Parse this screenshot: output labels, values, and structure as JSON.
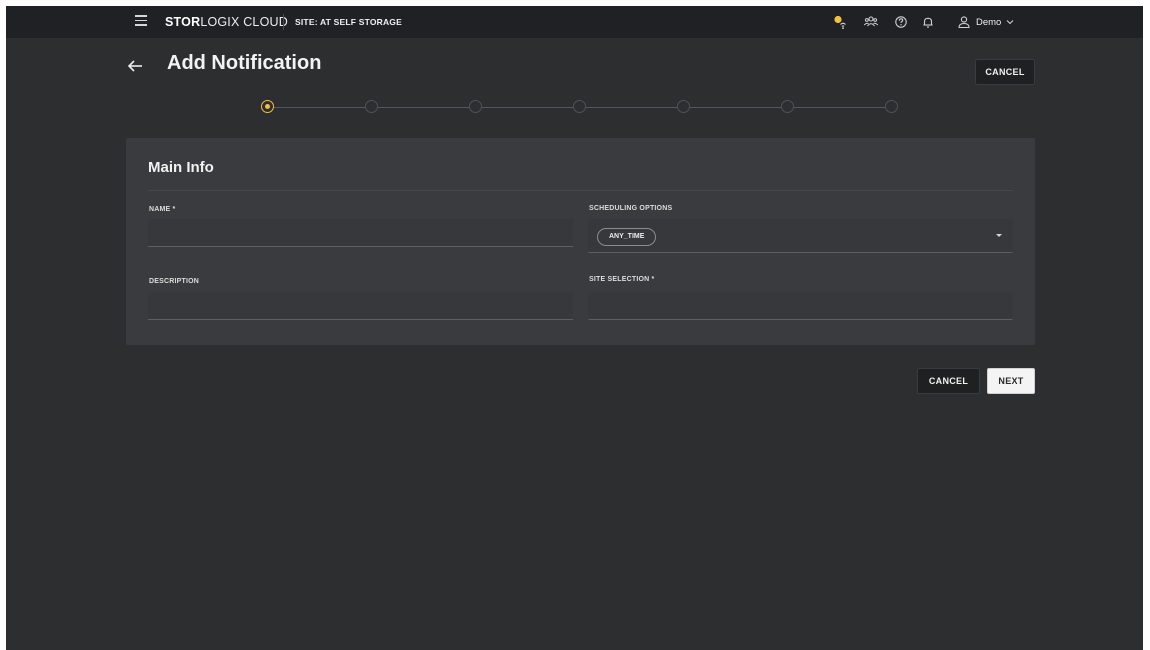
{
  "topbar": {
    "brand_bold": "STOR",
    "brand_rest": "LOGIX CLOUD",
    "site_label": "SITE: AT SELF STORAGE",
    "user_name": "Demo"
  },
  "header": {
    "title": "Add Notification",
    "cancel_label": "CANCEL"
  },
  "stepper": {
    "total_steps": 7,
    "active_step": 1
  },
  "card": {
    "title": "Main Info",
    "name_label": "NAME *",
    "name_value": "",
    "description_label": "DESCRIPTION",
    "description_value": "",
    "scheduling_label": "SCHEDULING OPTIONS",
    "scheduling_chip": "ANY_TIME",
    "site_selection_label": "SITE SELECTION *",
    "site_selection_value": ""
  },
  "footer": {
    "cancel_label": "CANCEL",
    "next_label": "NEXT"
  },
  "colors": {
    "accent": "#f2c044",
    "background": "#2d2e30",
    "topbar": "#202124",
    "card": "#3a3b3e"
  },
  "icons": {
    "menu": "hamburger-menu-icon",
    "weather": "sun-cloud-icon",
    "people": "people-icon",
    "help": "help-circle-icon",
    "notifications": "bell-icon",
    "user": "user-icon",
    "chevron": "chevron-down-icon",
    "back": "arrow-left-icon"
  }
}
